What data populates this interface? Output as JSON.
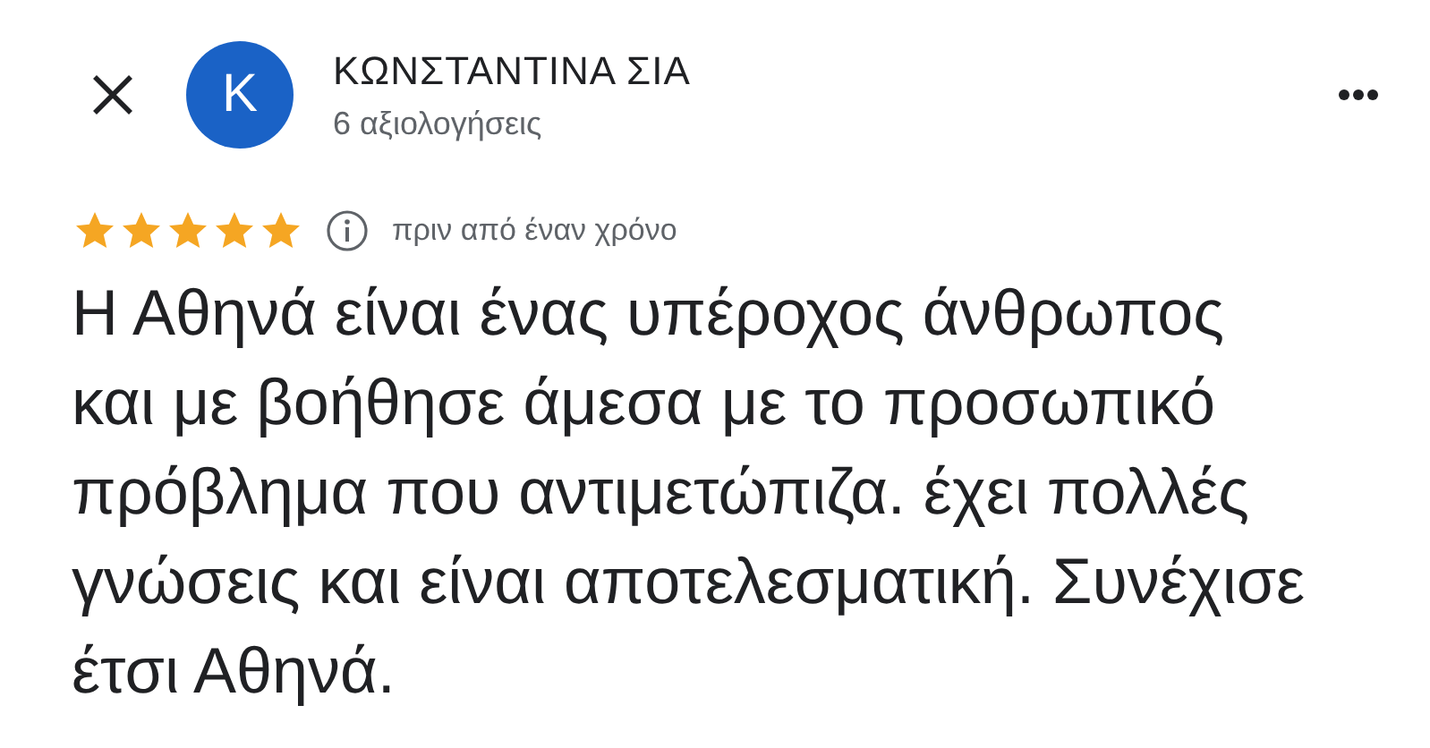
{
  "reviewer": {
    "initial": "K",
    "name": "ΚΩΝΣΤΑΝΤΙΝΑ ΣΙΑ",
    "reviews": "6 αξιολογήσεις"
  },
  "review": {
    "stars": 5,
    "time": "πριν από έναν χρόνο",
    "text": "Η Αθηνά είναι ένας υπέροχος άνθρωπος και με βοήθησε άμεσα με το προσωπικό πρόβλημα που αντιμετώπιζα. έχει πολλές γνώσεις και είναι αποτελεσματική. Συνέχισε έτσι Αθηνά."
  }
}
